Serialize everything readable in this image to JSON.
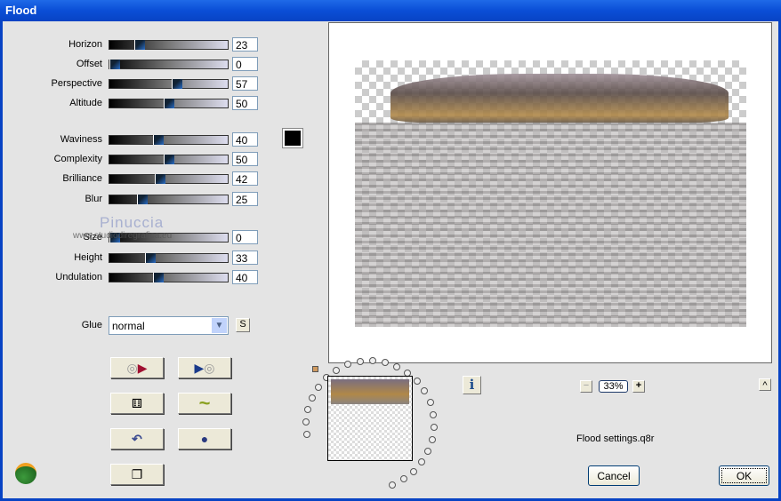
{
  "window": {
    "title": "Flood"
  },
  "sliders": [
    {
      "label": "Horizon",
      "value": "23"
    },
    {
      "label": "Offset",
      "value": "0"
    },
    {
      "label": "Perspective",
      "value": "57"
    },
    {
      "label": "Altitude",
      "value": "50"
    },
    {
      "label": "Waviness",
      "value": "40"
    },
    {
      "label": "Complexity",
      "value": "50"
    },
    {
      "label": "Brilliance",
      "value": "42"
    },
    {
      "label": "Blur",
      "value": "25"
    },
    {
      "label": "Size",
      "value": "0"
    },
    {
      "label": "Height",
      "value": "33"
    },
    {
      "label": "Undulation",
      "value": "40"
    }
  ],
  "color_swatch": "#000000",
  "glue": {
    "label": "Glue",
    "value": "normal",
    "s_button": "S"
  },
  "watermark": {
    "name": "Pinuccia",
    "site": "www.studiodiregrafica.eu"
  },
  "zoom": {
    "value": "33%",
    "minus": "−",
    "plus": "+"
  },
  "info_button": "i",
  "collapse_button": "^",
  "settings_file": "Flood settings.q8r",
  "buttons": {
    "cancel": "Cancel",
    "ok": "OK"
  }
}
